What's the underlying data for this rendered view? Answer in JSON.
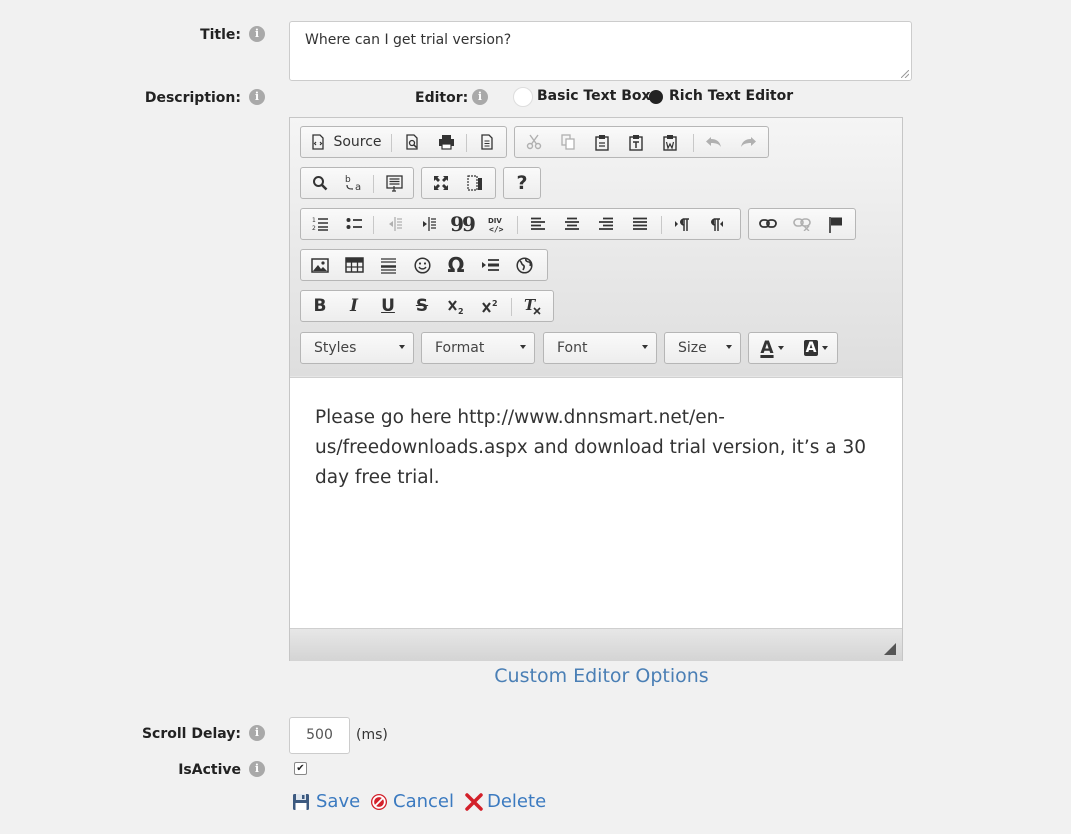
{
  "form": {
    "title_label": "Title:",
    "title_value": "Where can I get trial version?",
    "description_label": "Description:",
    "editor_label": "Editor:",
    "editor_options": [
      "Basic Text Box",
      "Rich Text Editor"
    ],
    "editor_selected": "Rich Text Editor",
    "scroll_delay_label": "Scroll Delay:",
    "scroll_delay_value": "500",
    "scroll_delay_unit": "(ms)",
    "isactive_label": "IsActive",
    "isactive_checked": true
  },
  "toolbar": {
    "source_label": "Source",
    "styles_label": "Styles",
    "format_label": "Format",
    "font_label": "Font",
    "size_label": "Size",
    "help_glyph": "?",
    "blockquote_glyph": "99",
    "omega_glyph": "Ω",
    "bold_glyph": "B",
    "italic_glyph": "I",
    "underline_glyph": "U",
    "strike_glyph": "S",
    "text_color_glyph": "A",
    "bg_color_glyph": "A"
  },
  "editor_content": "Please go here http://www.dnnsmart.net/en-us/freedownloads.aspx and download trial version, it’s a 30 day free trial.",
  "custom_editor_options": "Custom Editor Options",
  "actions": {
    "save": "Save",
    "cancel": "Cancel",
    "delete": "Delete"
  },
  "icons": {
    "info": "info-icon",
    "info_glyph": "i",
    "checkmark_glyph": "✔"
  },
  "colors": {
    "link": "#3b7ac0",
    "background": "#f1f1f1"
  }
}
